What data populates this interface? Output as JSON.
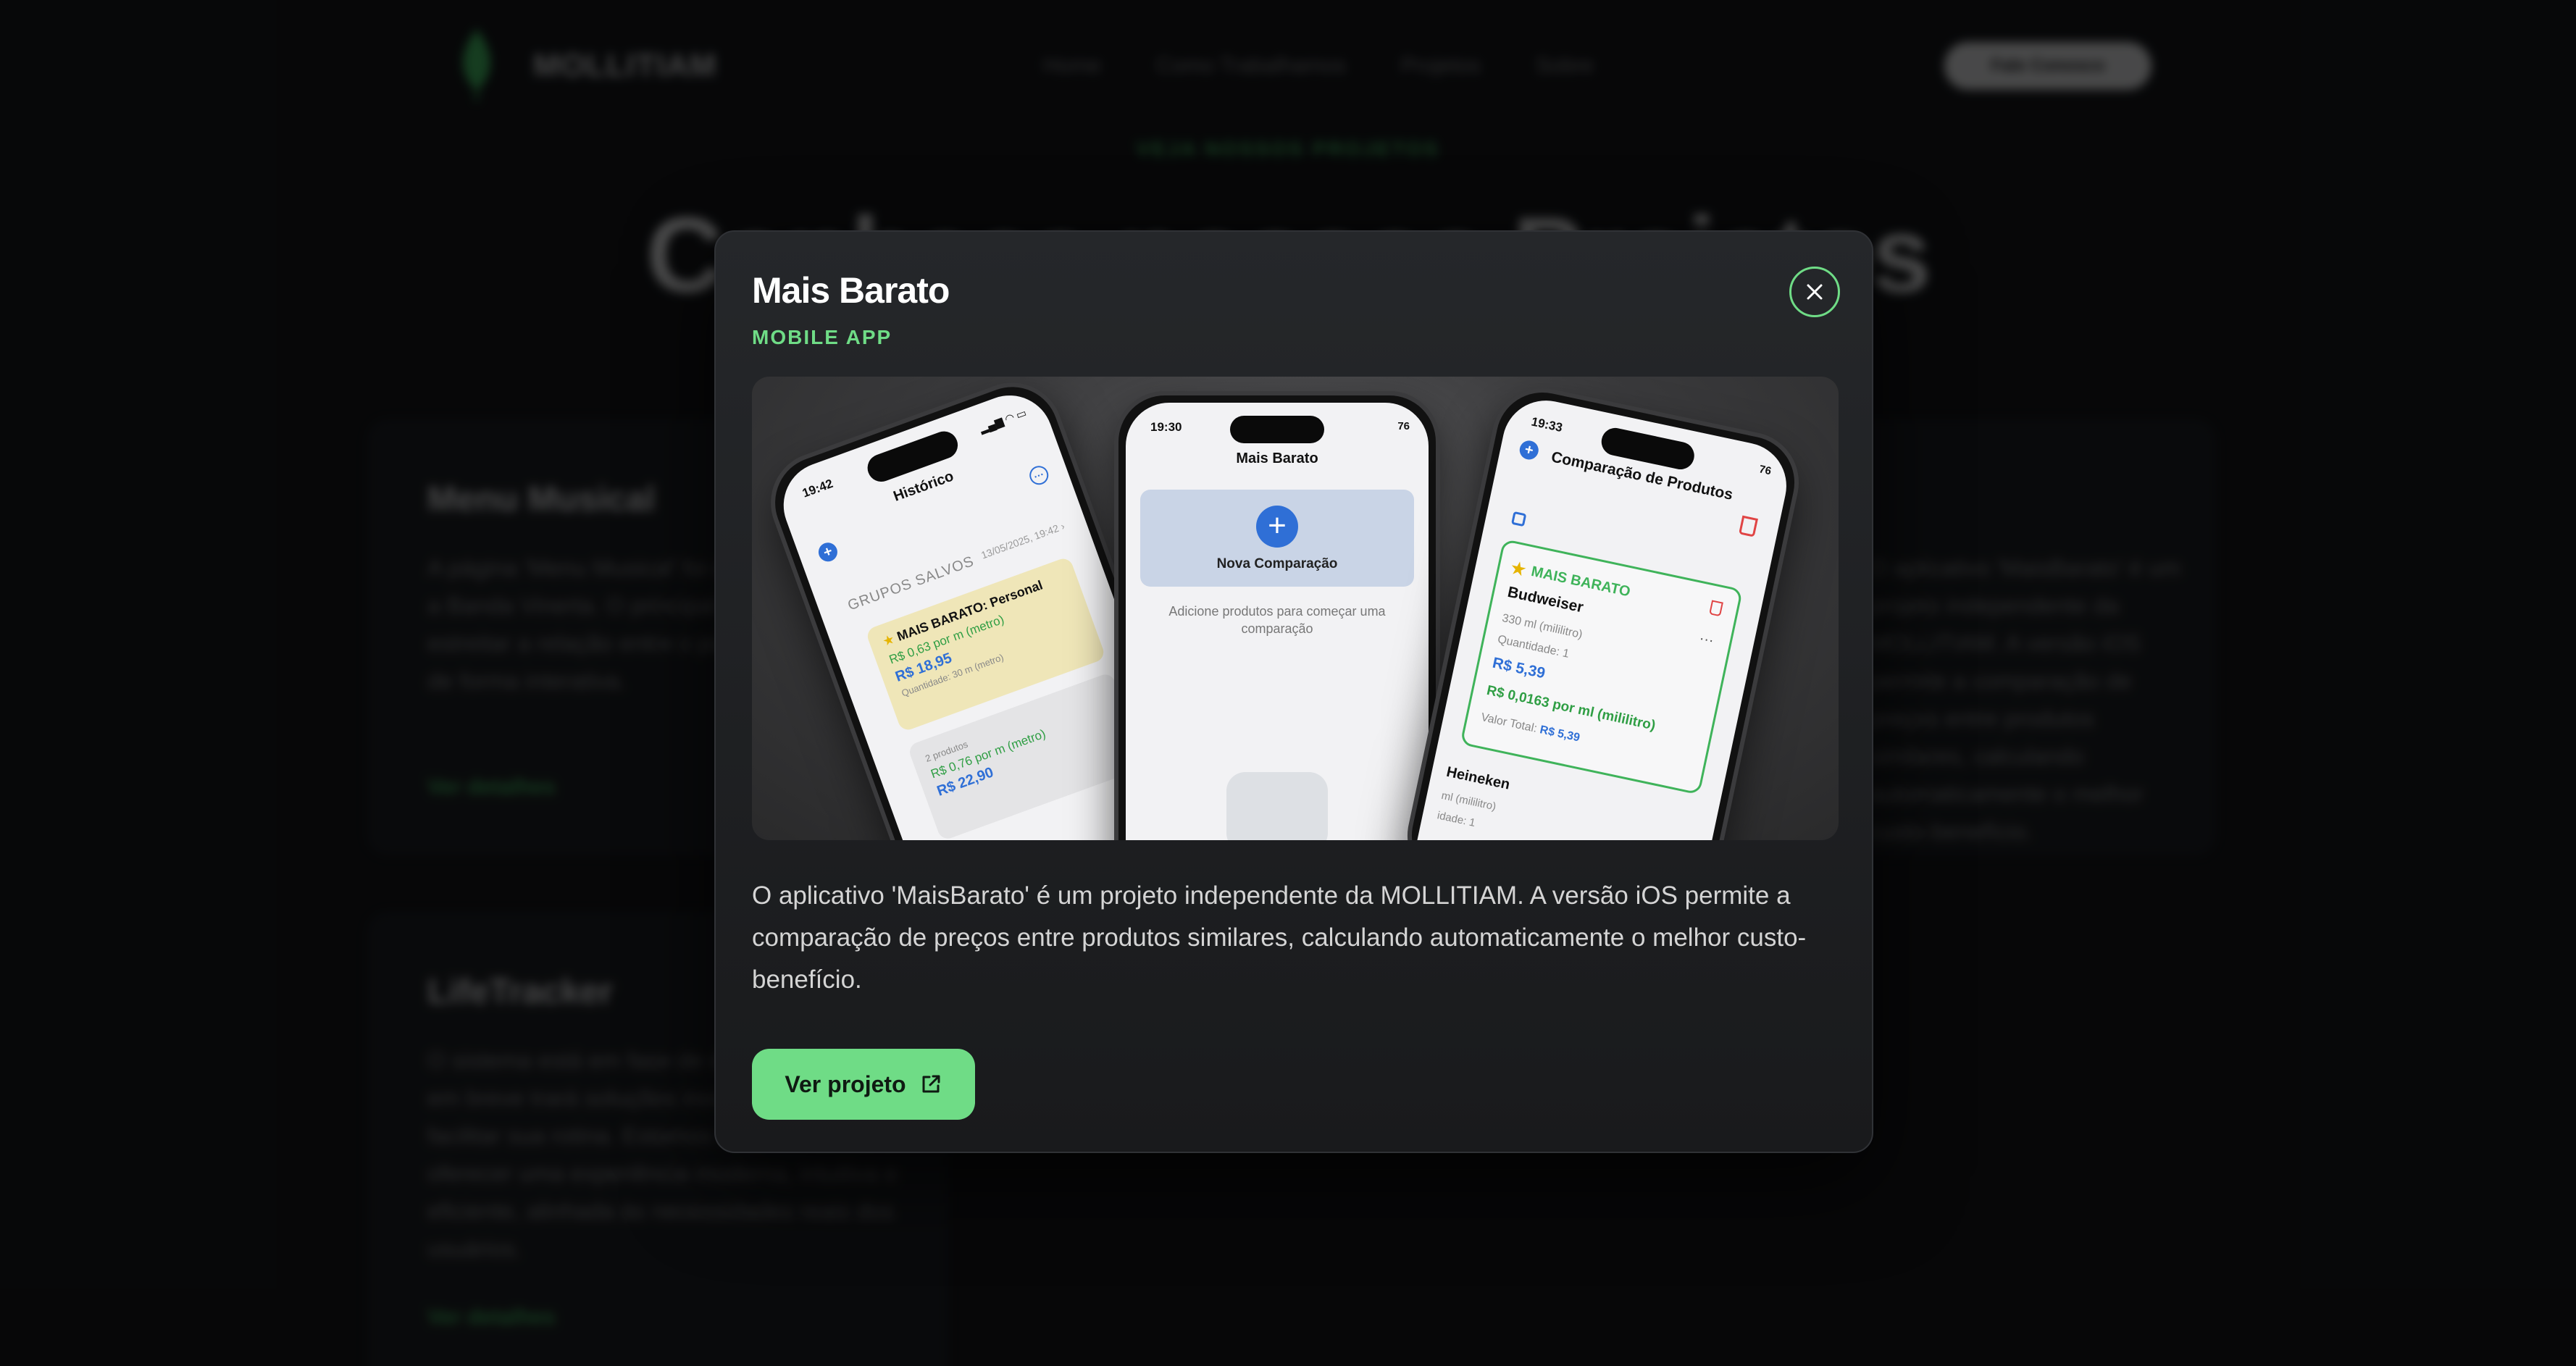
{
  "background": {
    "brand": "MOLLITIAM",
    "nav_links": [
      "Home",
      "Como Trabalhamos",
      "Projetos",
      "Sobre"
    ],
    "nav_cta": "Fale Conosco",
    "eyebrow": "VEJA NOSSOS PROJETOS",
    "hero_title": "Conheça nossos Projetos",
    "cards": [
      {
        "title": "Menu Musical",
        "text": "A página 'Menu Musical' foi desenvolvida para a Banda Vinerta. O principal objetivo é estreitar a relação entre o público e a música, de forma interativa.",
        "link": "Ver detalhes"
      },
      {
        "title": "LifeTracker",
        "text": "O sistema está em fase de desenvolvimento e em breve trará soluções inovadoras para facilitar sua rotina. Estamos trabalhando para oferecer uma experiência moderna, intuitiva e eficiente, alinhada às necessidades reais dos usuários.",
        "link": "Ver detalhes"
      },
      {
        "text": "O aplicativo 'MaisBarato' é um projeto independente da MOLLITIAM. A versão iOS permite a comparação de preços entre produtos similares, calculando automaticamente o melhor custo-benefício."
      }
    ]
  },
  "modal": {
    "title": "Mais Barato",
    "category": "MOBILE APP",
    "close_icon": "close-icon",
    "description": "O aplicativo 'MaisBarato' é um projeto independente da MOLLITIAM. A versão iOS permite a comparação de preços entre produtos similares, calculando automaticamente o melhor custo-benefício.",
    "cta_label": "Ver projeto",
    "cta_icon": "external-link-icon",
    "accent_color": "#6fdc86"
  },
  "phones": {
    "left": {
      "time": "19:42",
      "title": "Histórico",
      "group_label": "GRUPOS SALVOS",
      "date": "13/05/2025, 19:42 ›",
      "card1": {
        "title": "MAIS BARATO: Personal",
        "unit_price": "R$ 0,63 por m (metro)",
        "price": "R$ 18,95",
        "qty": "Quantidade: 30 m (metro)"
      },
      "card2": {
        "count": "2 produtos",
        "unit_price": "R$ 0,76 por m (metro)",
        "price": "R$ 22,90"
      }
    },
    "center": {
      "time": "19:30",
      "battery": "76",
      "title": "Mais Barato",
      "new_label": "Nova Comparação",
      "hint": "Adicione produtos para começar uma comparação"
    },
    "right": {
      "time": "19:33",
      "battery": "76",
      "title": "Comparação de Produtos",
      "badge": "MAIS BARATO",
      "name": "Budweiser",
      "size": "330 ml (mililitro)",
      "qty": "Quantidade: 1",
      "price": "R$ 5,39",
      "unit_price": "R$ 0,0163 por ml (mililitro)",
      "total_label": "Valor Total:",
      "total_value": "R$ 5,39",
      "next_name": "Heineken",
      "next_size": "ml (mililitro)",
      "next_qty": "idade: 1"
    }
  }
}
